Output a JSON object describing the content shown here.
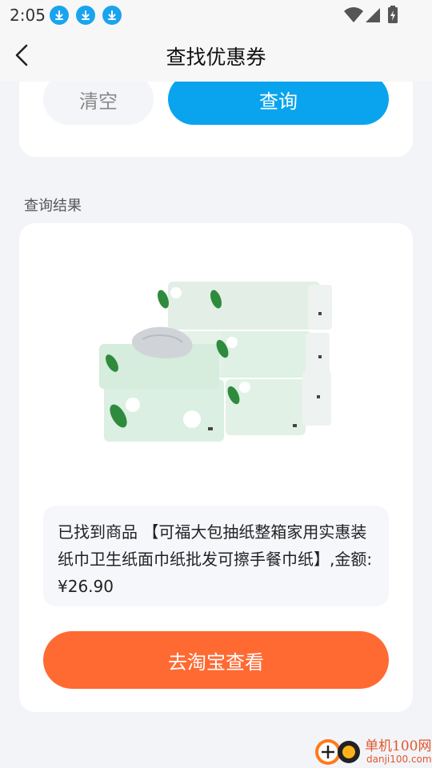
{
  "status_bar": {
    "time": "2:05"
  },
  "header": {
    "title": "查找优惠券",
    "back_icon": "back-arrow-icon"
  },
  "search_card": {
    "clear_label": "清空",
    "query_label": "查询"
  },
  "results": {
    "section_label": "查询结果",
    "product_image": "tissue-pack-image",
    "description": "已找到商品 【可福大包抽纸整箱家用实惠装纸巾卫生纸面巾纸批发可擦手餐巾纸】,金额:¥26.90",
    "action_label": "去淘宝查看"
  },
  "watermark": {
    "brand": "单机100网",
    "site": "danji100.com"
  },
  "colors": {
    "accent_blue": "#0aa4ee",
    "accent_orange": "#ff6a33",
    "background": "#f3f4f8"
  }
}
